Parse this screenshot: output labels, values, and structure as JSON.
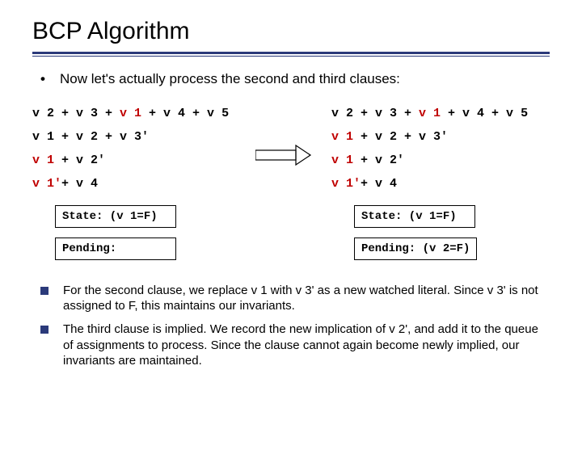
{
  "title": "BCP Algorithm",
  "intro": "Now let's actually process the second and third clauses:",
  "left": {
    "c1_a": "v 2 + v 3 + ",
    "c1_b": "v 1",
    "c1_c": " + v 4 + v 5",
    "c2_a": "v 1 + v 2 + v 3'",
    "c3_a": "v 1",
    "c3_b": " + v 2'",
    "c4_a": "v 1'",
    "c4_b": "+ v 4",
    "state": "State: (v 1=F)",
    "pending": "Pending:"
  },
  "right": {
    "c1_a": "v 2 + v 3 + ",
    "c1_b": "v 1",
    "c1_c": " + v 4 + v 5",
    "c2_a": "v 1",
    "c2_b": " + v 2 + v 3'",
    "c3_a": "v 1",
    "c3_b": " + v 2'",
    "c4_a": "v 1'",
    "c4_b": "+ v 4",
    "state": "State: (v 1=F)",
    "pending": "Pending: (v 2=F)"
  },
  "foot1": "For the second clause, we replace v 1 with v 3' as a new watched literal. Since v 3' is not assigned to F, this maintains our invariants.",
  "foot2": "The third clause is implied. We record the new implication of v 2', and add it to the queue of assignments to process. Since the clause cannot again become newly implied, our invariants are maintained."
}
